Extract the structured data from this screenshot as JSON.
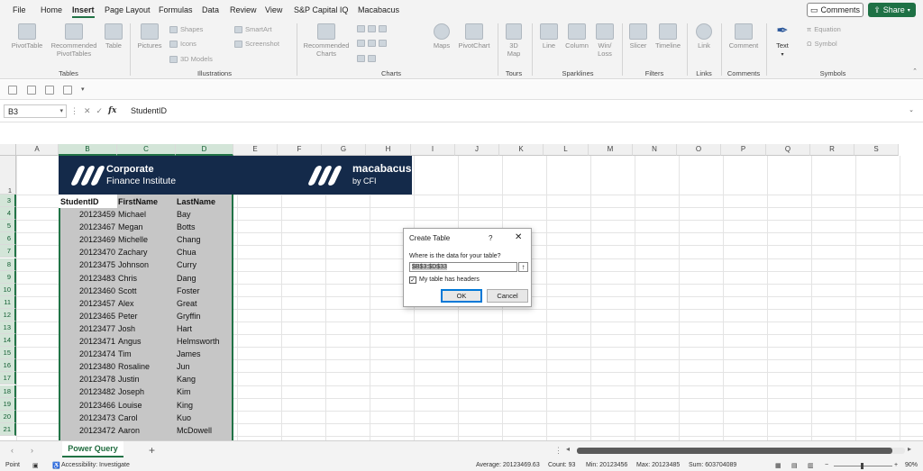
{
  "menu": {
    "items": [
      "File",
      "Home",
      "Insert",
      "Page Layout",
      "Formulas",
      "Data",
      "Review",
      "View",
      "S&P Capital IQ",
      "Macabacus"
    ],
    "active": "Insert",
    "comments_label": "Comments",
    "share_label": "Share"
  },
  "ribbon": {
    "groups": {
      "tables": "Tables",
      "illustrations": "Illustrations",
      "charts": "Charts",
      "tours": "Tours",
      "sparklines": "Sparklines",
      "filters": "Filters",
      "links": "Links",
      "comments": "Comments",
      "symbols": "Symbols"
    },
    "buttons": {
      "pivottable": "PivotTable",
      "recommended_pivottables_1": "Recommended",
      "recommended_pivottables_2": "PivotTables",
      "table": "Table",
      "pictures": "Pictures",
      "shapes": "Shapes",
      "icons": "Icons",
      "models3d": "3D Models",
      "smartart": "SmartArt",
      "screenshot": "Screenshot",
      "recommended_charts_1": "Recommended",
      "recommended_charts_2": "Charts",
      "maps": "Maps",
      "pivotchart": "PivotChart",
      "map3d_1": "3D",
      "map3d_2": "Map",
      "line": "Line",
      "column": "Column",
      "winloss_1": "Win/",
      "winloss_2": "Loss",
      "slicer": "Slicer",
      "timeline": "Timeline",
      "link": "Link",
      "comment": "Comment",
      "text": "Text",
      "equation": "Equation",
      "symbol": "Symbol"
    }
  },
  "formula_bar": {
    "name_box": "B3",
    "fx": "fx",
    "content": "StudentID"
  },
  "columns": [
    "A",
    "B",
    "C",
    "D",
    "E",
    "F",
    "G",
    "H",
    "I",
    "J",
    "K",
    "L",
    "M",
    "N",
    "O",
    "P",
    "Q",
    "R",
    "S"
  ],
  "rows": [
    "1",
    "3",
    "4",
    "5",
    "6",
    "7",
    "8",
    "9",
    "10",
    "11",
    "12",
    "13",
    "14",
    "15",
    "16",
    "17",
    "18",
    "19",
    "20",
    "21"
  ],
  "banner": {
    "cfi_line1": "Corporate",
    "cfi_line2": "Finance Institute",
    "macabacus": "macabacus",
    "by_cfi": "by CFI"
  },
  "table": {
    "headers": [
      "StudentID",
      "FirstName",
      "LastName"
    ],
    "rows": [
      [
        "20123459",
        "Michael",
        "Bay"
      ],
      [
        "20123467",
        "Megan",
        "Botts"
      ],
      [
        "20123469",
        "Michelle",
        "Chang"
      ],
      [
        "20123470",
        "Zachary",
        "Chua"
      ],
      [
        "20123475",
        "Johnson",
        "Curry"
      ],
      [
        "20123483",
        "Chris",
        "Dang"
      ],
      [
        "20123460",
        "Scott",
        "Foster"
      ],
      [
        "20123457",
        "Alex",
        "Great"
      ],
      [
        "20123465",
        "Peter",
        "Gryffin"
      ],
      [
        "20123477",
        "Josh",
        "Hart"
      ],
      [
        "20123471",
        "Angus",
        "Helmsworth"
      ],
      [
        "20123474",
        "Tim",
        "James"
      ],
      [
        "20123480",
        "Rosaline",
        "Jun"
      ],
      [
        "20123478",
        "Justin",
        "Kang"
      ],
      [
        "20123482",
        "Joseph",
        "Kim"
      ],
      [
        "20123466",
        "Louise",
        "King"
      ],
      [
        "20123473",
        "Carol",
        "Kuo"
      ],
      [
        "20123472",
        "Aaron",
        "McDowell"
      ]
    ]
  },
  "dialog": {
    "title": "Create Table",
    "help": "?",
    "close": "✕",
    "question": "Where is the data for your table?",
    "range": "$B$3:$D$33",
    "headers_label": "My table has headers",
    "headers_checked": true,
    "ok": "OK",
    "cancel": "Cancel"
  },
  "sheet_tabs": {
    "active": "Power Query",
    "add": "+"
  },
  "status_bar": {
    "mode": "Point",
    "accessibility": "Accessibility: Investigate",
    "average": "Average: 20123469.63",
    "count": "Count: 93",
    "min": "Min: 20123456",
    "max": "Max: 20123485",
    "sum": "Sum: 603704089",
    "zoom": "90%"
  },
  "colors": {
    "excel_green": "#217346",
    "banner_navy": "#142a4a",
    "selection_gray": "#c6c6c6"
  }
}
